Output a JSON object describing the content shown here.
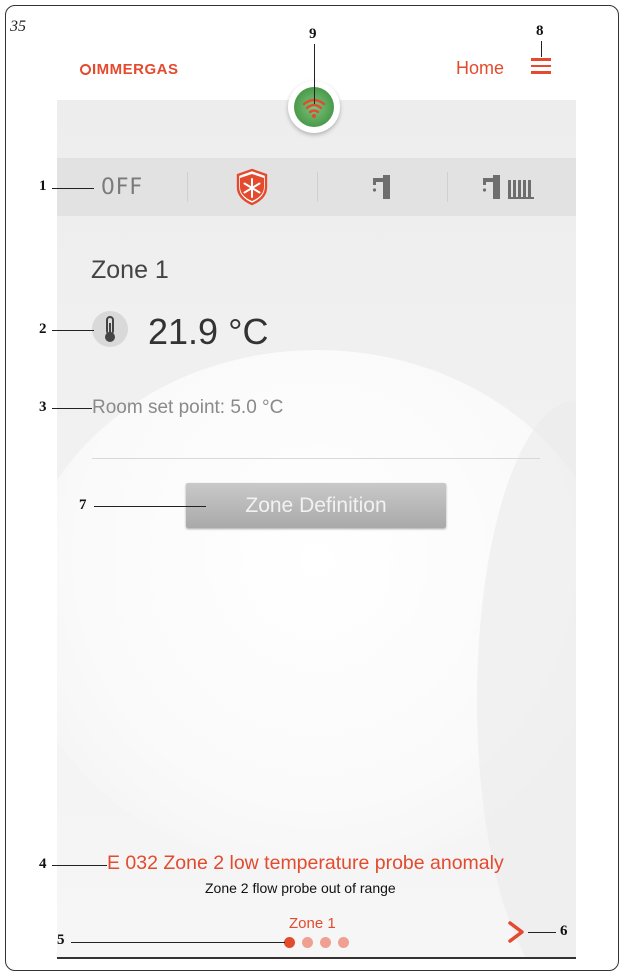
{
  "page_number": "35",
  "callouts": [
    "1",
    "2",
    "3",
    "4",
    "5",
    "6",
    "7",
    "8",
    "9"
  ],
  "header": {
    "logo_text": "IMMERGAS",
    "home_label": "Home"
  },
  "modes": {
    "off_label": "0FF"
  },
  "zone": {
    "title": "Zone 1",
    "temperature": "21.9 °C",
    "set_point": "Room set point: 5.0 °C",
    "definition_button": "Zone Definition"
  },
  "error": {
    "code_text": "E 032 Zone 2 low temperature probe anomaly",
    "detail": "Zone 2 flow probe out of range"
  },
  "footer": {
    "zone_label": "Zone 1",
    "page_dots": 4,
    "active_dot": 1
  },
  "colors": {
    "accent": "#e34a2e",
    "wifi_ok": "#4a9a4a",
    "mode_bar": "#e2e2e2",
    "button_gray": "#b5b5b5"
  },
  "icons": [
    "menu-icon",
    "wifi-icon",
    "snowflake-shield-icon",
    "tap-icon",
    "tap-radiator-icon",
    "thermometer-icon",
    "chevron-right-icon"
  ]
}
